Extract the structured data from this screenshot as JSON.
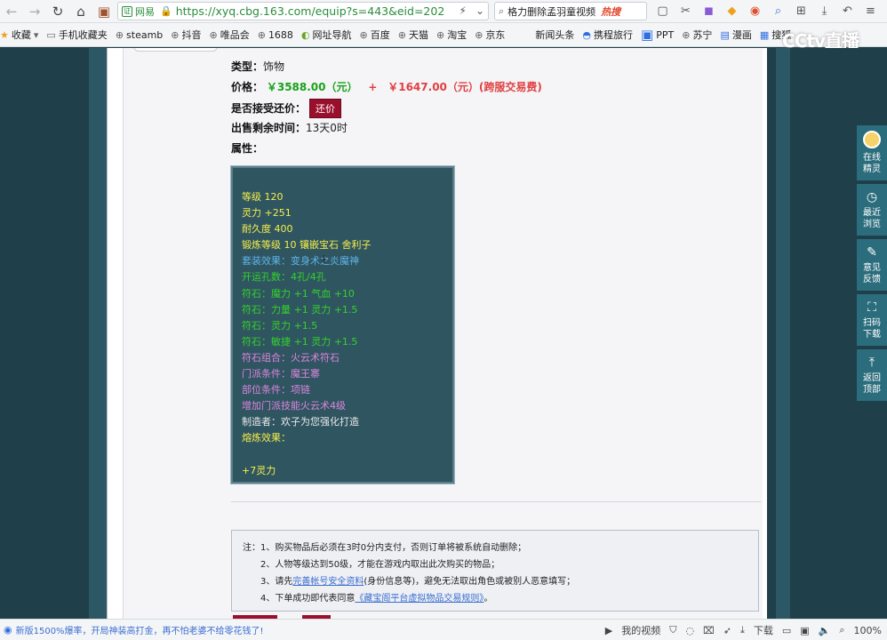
{
  "browser": {
    "site_chip": "网易",
    "url": "https://xyq.cbg.163.com/equip?s=443&eid=202",
    "search_text": "格力删除孟羽童视频",
    "search_hot": "热搜"
  },
  "bookmarks": [
    "收藏",
    "手机收藏夹",
    "steamb",
    "抖音",
    "唯品会",
    "1688",
    "网址导航",
    "百度",
    "天猫",
    "淘宝",
    "京东",
    "新闻头条",
    "携程旅行",
    "PPT",
    "苏宁",
    "漫画",
    "搜狐"
  ],
  "overlay_logo": "CCtv直播",
  "item": {
    "type_label": "类型：",
    "type_value": "饰物",
    "price_label": "价格：",
    "price_value": "￥3588.00（元）",
    "plus": "+",
    "fee_value": "￥1647.00（元）(跨服交易费)",
    "counter_label": "是否接受还价：",
    "counter_button": "还价",
    "time_label": "出售剩余时间：",
    "time_value": "13天0时",
    "attr_label": "属性："
  },
  "attributes": [
    {
      "text": "等级 120",
      "color": "yellow"
    },
    {
      "text": "灵力 +251",
      "color": "yellow"
    },
    {
      "text": "耐久度 400",
      "color": "yellow"
    },
    {
      "text": "锻炼等级 10 镶嵌宝石 舍利子",
      "color": "yellow"
    },
    {
      "text": "套装效果：变身术之炎魔神",
      "color": "blue"
    },
    {
      "text": "开运孔数：4孔/4孔",
      "color": "green"
    },
    {
      "text": "符石：魔力 +1 气血 +10",
      "color": "green"
    },
    {
      "text": "符石：力量 +1 灵力 +1.5",
      "color": "green"
    },
    {
      "text": "符石：灵力 +1.5",
      "color": "green"
    },
    {
      "text": "符石：敏捷 +1 灵力 +1.5",
      "color": "green"
    },
    {
      "text": "符石组合：火云术符石",
      "color": "purple"
    },
    {
      "text": "门派条件：魔王寨",
      "color": "purple"
    },
    {
      "text": "部位条件：项链",
      "color": "purple"
    },
    {
      "text": "增加门派技能火云术4级",
      "color": "purple"
    },
    {
      "text": "制造者：欢子为您强化打造",
      "color": "white"
    },
    {
      "text": "熔炼效果：",
      "color": "yellow"
    },
    {
      "text": "",
      "color": "yellow"
    },
    {
      "text": "+7灵力",
      "color": "yellow"
    }
  ],
  "notes": {
    "line1": "注：1、购买物品后必须在3时0分内支付，否则订单将被系统自动删除；",
    "line2": "2、人物等级达到50级，才能在游戏内取出此次购买的物品；",
    "line3_pre": "3、请先",
    "line3_link": "完善帐号安全资料",
    "line3_post": "(身份信息等)，避免无法取出角色或被别人恶意填写；",
    "line4_pre": "4、下单成功即代表同意",
    "line4_link": "《藏宝阁平台虚拟物品交易规则》",
    "line4_post": "。"
  },
  "float_bar": [
    {
      "label1": "在线",
      "label2": "精灵",
      "icon": "avatar"
    },
    {
      "label1": "最近",
      "label2": "浏览",
      "icon": "clock-icon"
    },
    {
      "label1": "意见",
      "label2": "反馈",
      "icon": "edit-icon"
    },
    {
      "label1": "扫码",
      "label2": "下载",
      "icon": "scan-icon"
    },
    {
      "label1": "返回",
      "label2": "顶部",
      "icon": "top-icon"
    }
  ],
  "status": {
    "news": "新版1500%爆率，开局神装高打金，再不怕老婆不给零花钱了!",
    "my_video": "我的视频",
    "download": "下载",
    "zoom": "100%"
  }
}
